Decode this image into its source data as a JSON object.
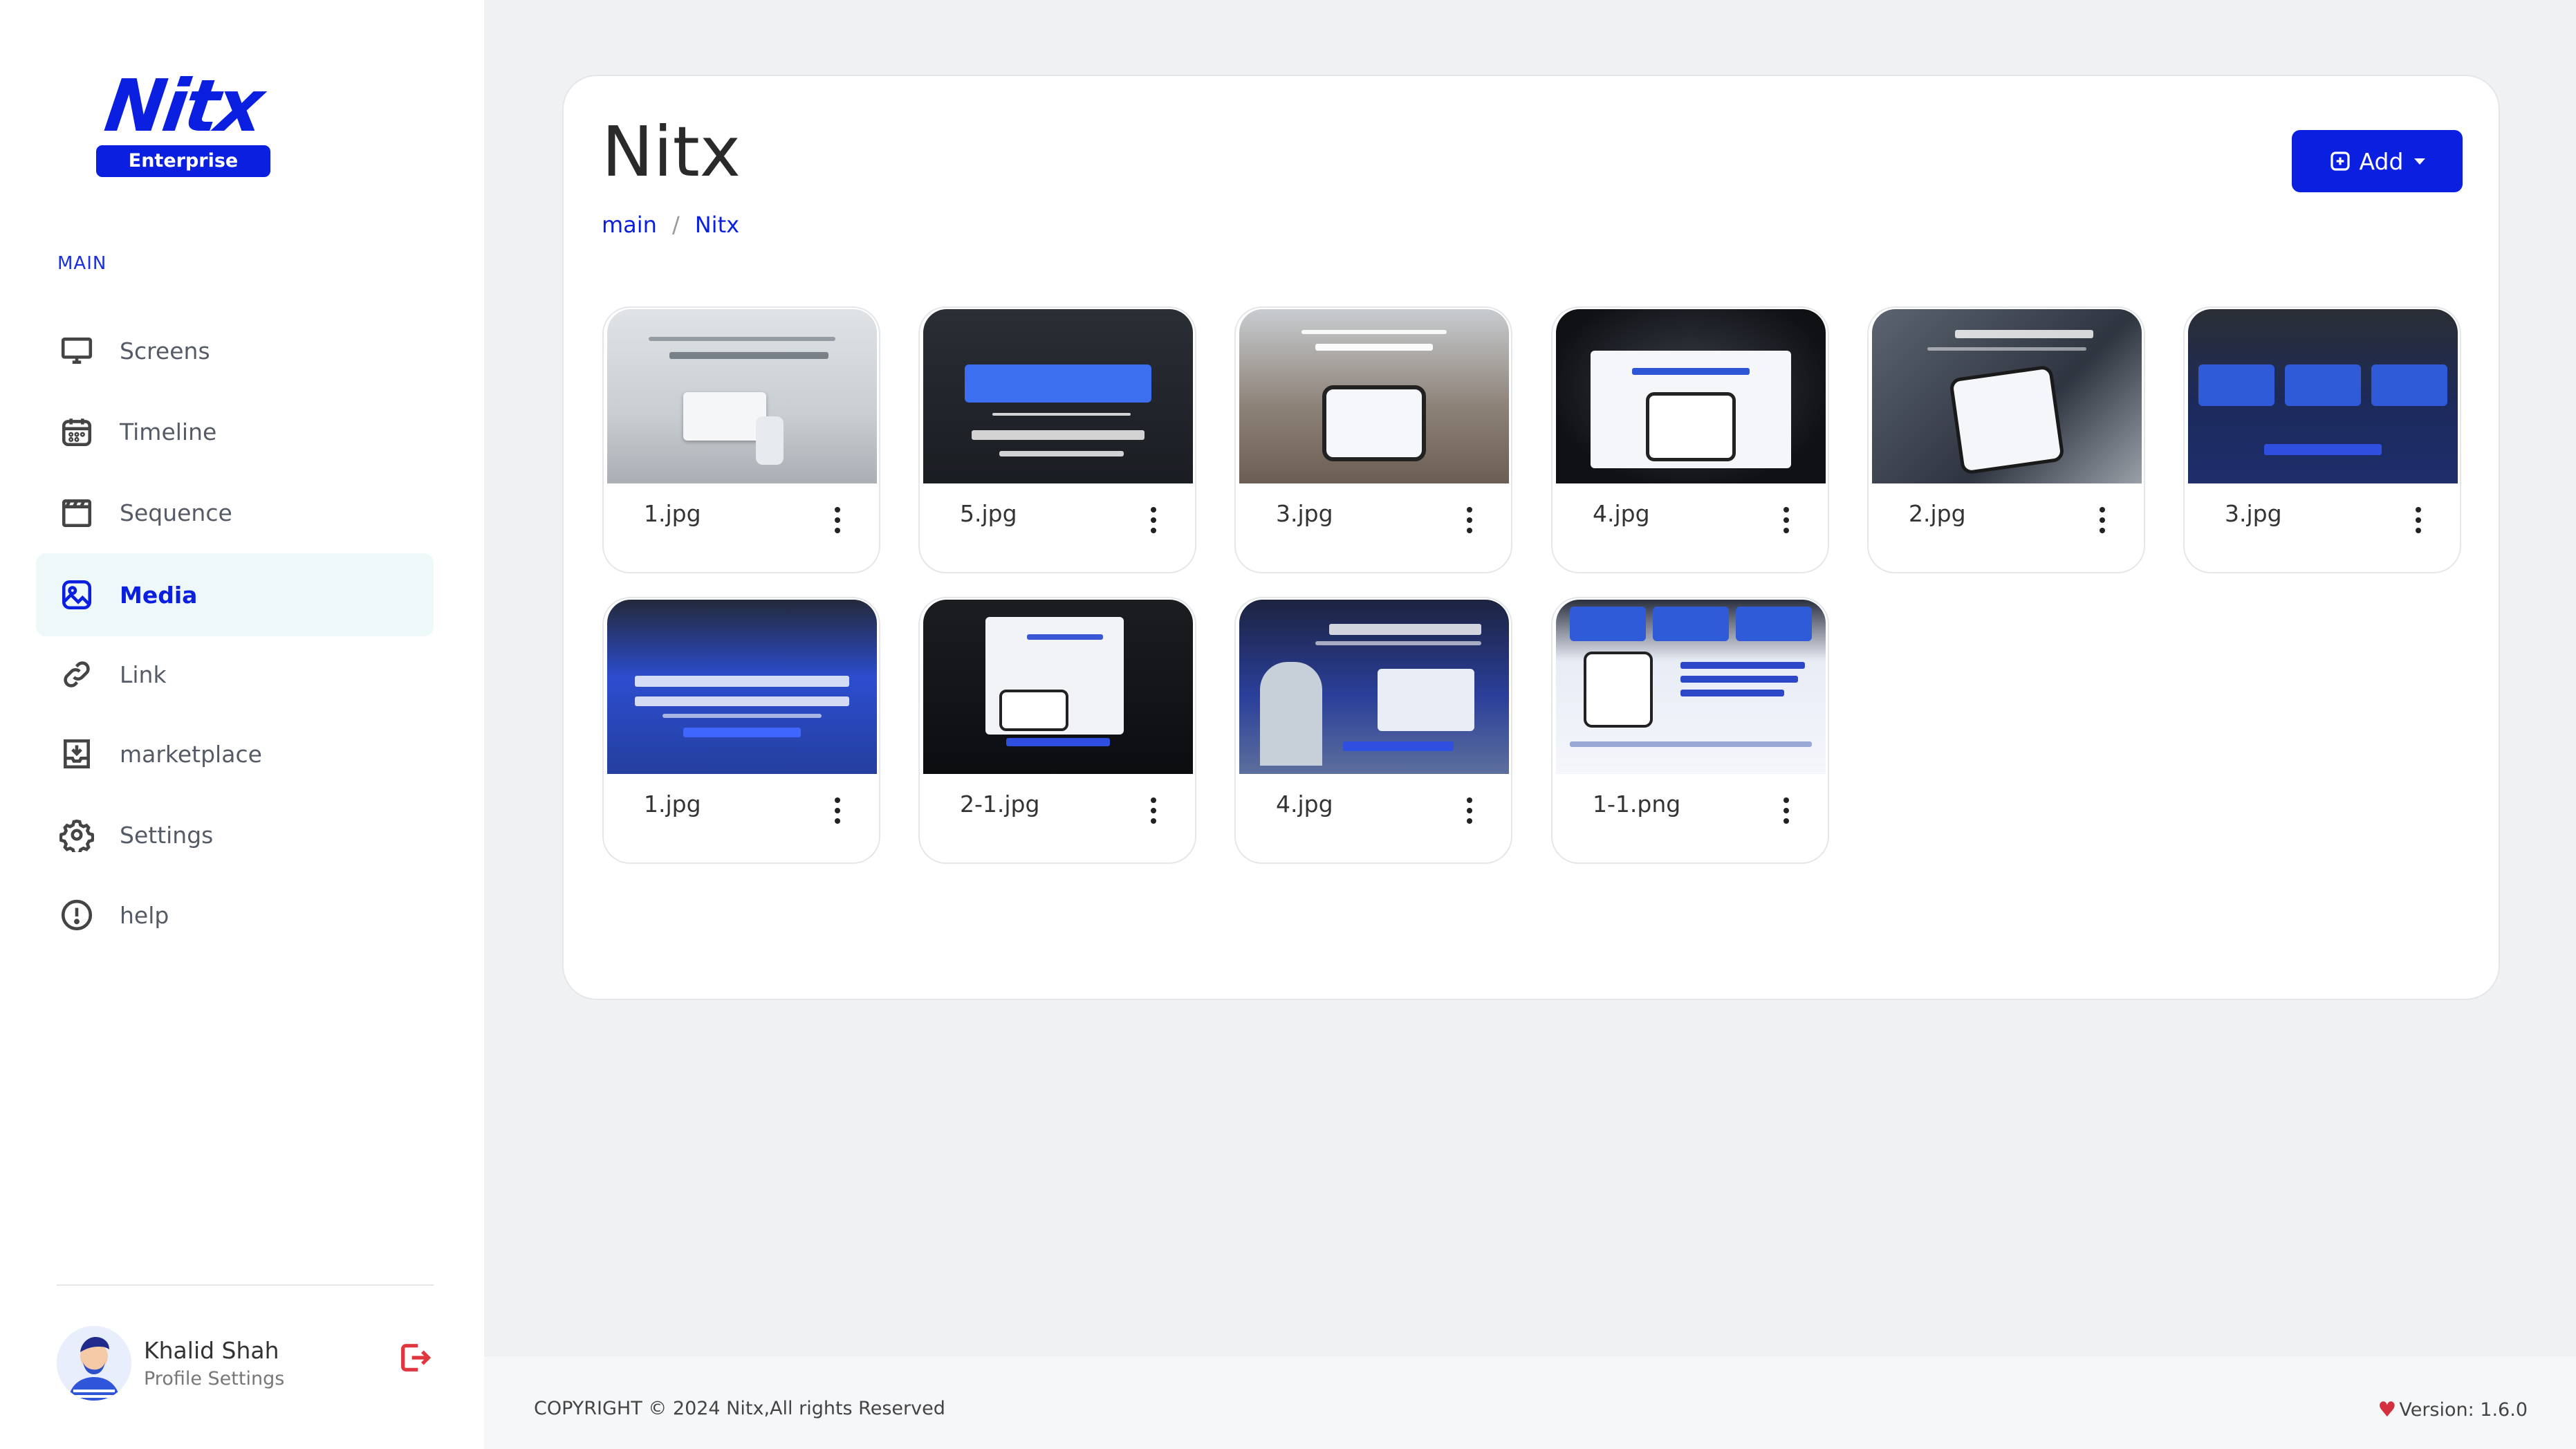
{
  "brand": {
    "logo_text": "Nitx",
    "badge": "Enterprise",
    "color": "#0a1fe0"
  },
  "sidebar": {
    "section_label": "MAIN",
    "items": [
      {
        "label": "Screens",
        "icon": "monitor-icon",
        "active": false
      },
      {
        "label": "Timeline",
        "icon": "calendar-icon",
        "active": false
      },
      {
        "label": "Sequence",
        "icon": "clapperboard-icon",
        "active": false
      },
      {
        "label": "Media",
        "icon": "image-icon",
        "active": true
      },
      {
        "label": "Link",
        "icon": "link-icon",
        "active": false
      },
      {
        "label": "marketplace",
        "icon": "download-box-icon",
        "active": false
      },
      {
        "label": "Settings",
        "icon": "gear-icon",
        "active": false
      },
      {
        "label": "help",
        "icon": "info-circle-icon",
        "active": false
      }
    ],
    "user": {
      "name": "Khalid Shah",
      "subtitle": "Profile Settings"
    }
  },
  "main": {
    "title": "Nitx",
    "breadcrumb": [
      "main",
      "Nitx"
    ],
    "add_button": "Add",
    "media": [
      {
        "name": "1.jpg"
      },
      {
        "name": "5.jpg"
      },
      {
        "name": "3.jpg"
      },
      {
        "name": "4.jpg"
      },
      {
        "name": "2.jpg"
      },
      {
        "name": "3.jpg"
      },
      {
        "name": "1.jpg"
      },
      {
        "name": "2-1.jpg"
      },
      {
        "name": "4.jpg"
      },
      {
        "name": "1-1.png"
      }
    ]
  },
  "footer": {
    "copyright": "COPYRIGHT © 2024 Nitx,All rights Reserved",
    "version": "Version: 1.6.0"
  }
}
